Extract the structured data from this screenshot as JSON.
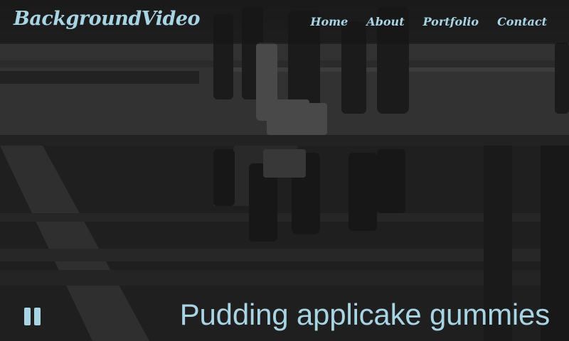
{
  "brand": {
    "label": "BackgroundVideo"
  },
  "nav": {
    "items": [
      {
        "label": "Home"
      },
      {
        "label": "About"
      },
      {
        "label": "Portfolio"
      },
      {
        "label": "Contact"
      }
    ]
  },
  "video": {
    "control_icon": "pause-icon",
    "caption": "Pudding applicake gummies"
  },
  "colors": {
    "accent": "#a9d4e4",
    "navbar_bg": "#141414"
  }
}
